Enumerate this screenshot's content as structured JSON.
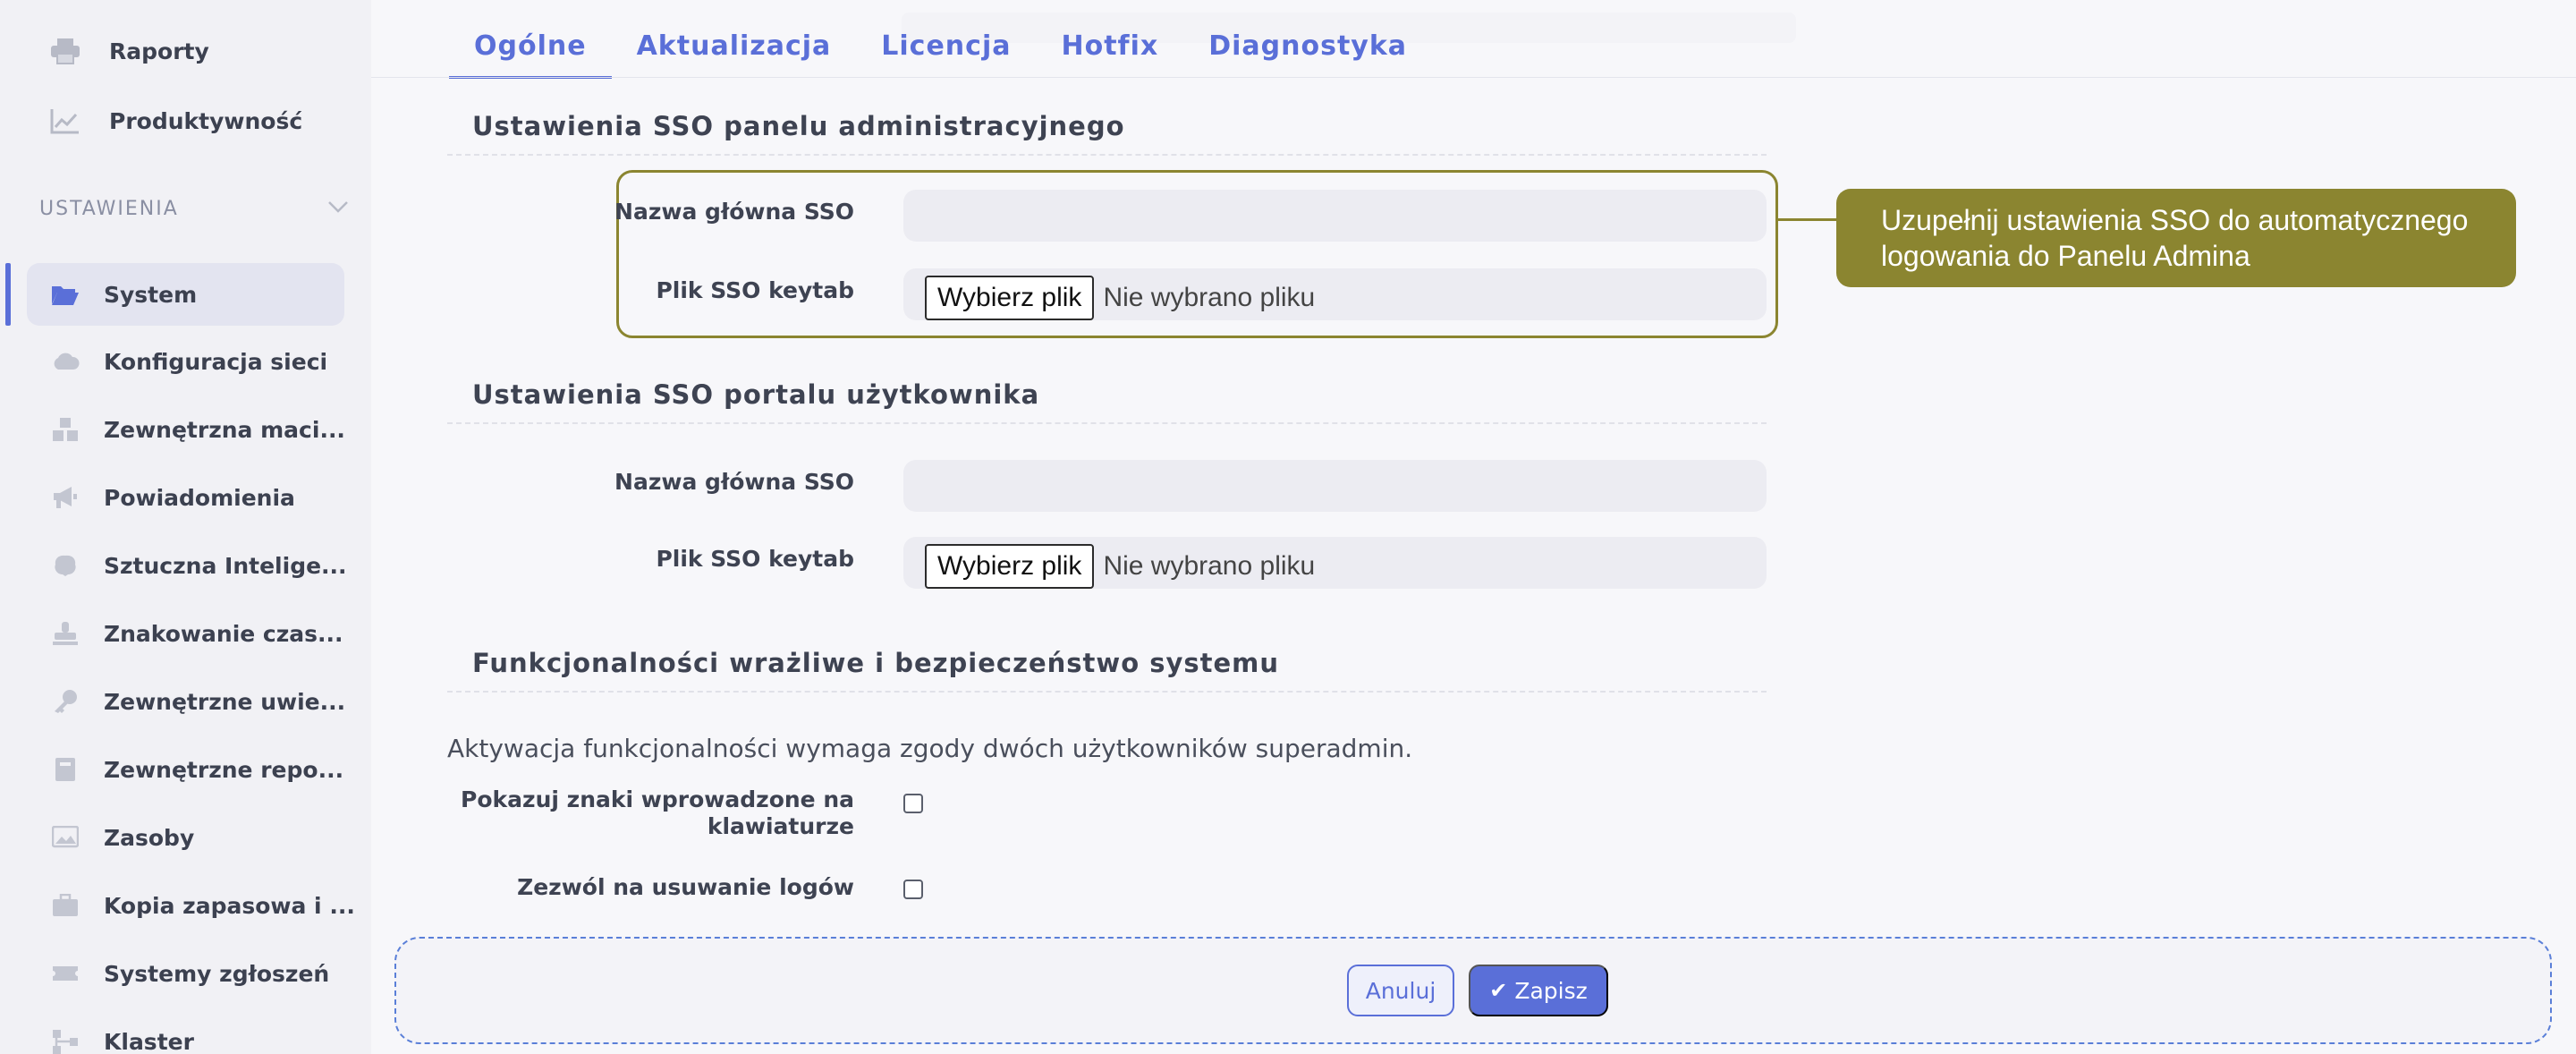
{
  "sidebar": {
    "top_items": [
      {
        "label": "Raporty",
        "icon": "printer-icon"
      },
      {
        "label": "Produktywność",
        "icon": "chart-line-icon"
      }
    ],
    "section_title": "USTAWIENIA",
    "items": [
      {
        "label": "System",
        "icon": "folder-open-icon",
        "active": true
      },
      {
        "label": "Konfiguracja sieci",
        "icon": "cloud-icon"
      },
      {
        "label": "Zewnętrzna maci...",
        "icon": "cubes-icon"
      },
      {
        "label": "Powiadomienia",
        "icon": "megaphone-icon"
      },
      {
        "label": "Sztuczna Intelige...",
        "icon": "brain-icon"
      },
      {
        "label": "Znakowanie czas...",
        "icon": "stamp-icon"
      },
      {
        "label": "Zewnętrzne uwie...",
        "icon": "key-icon"
      },
      {
        "label": "Zewnętrzne repo...",
        "icon": "book-icon"
      },
      {
        "label": "Zasoby",
        "icon": "image-icon"
      },
      {
        "label": "Kopia zapasowa i ...",
        "icon": "briefcase-icon"
      },
      {
        "label": "Systemy zgłoszeń",
        "icon": "ticket-icon"
      },
      {
        "label": "Klaster",
        "icon": "network-icon"
      }
    ]
  },
  "tabs": [
    {
      "label": "Ogólne",
      "active": true
    },
    {
      "label": "Aktualizacja"
    },
    {
      "label": "Licencja"
    },
    {
      "label": "Hotfix"
    },
    {
      "label": "Diagnostyka"
    }
  ],
  "sso_admin": {
    "heading": "Ustawienia SSO panelu administracyjnego",
    "name_label": "Nazwa główna SSO",
    "name_value": "",
    "keytab_label": "Plik SSO keytab",
    "file_button": "Wybierz plik",
    "file_status": "Nie wybrano pliku"
  },
  "callout": {
    "text": "Uzupełnij ustawienia SSO do automatycznego logowania do Panelu Admina",
    "color": "#8b8530"
  },
  "sso_user": {
    "heading": "Ustawienia SSO portalu użytkownika",
    "name_label": "Nazwa główna SSO",
    "name_value": "",
    "keytab_label": "Plik SSO keytab",
    "file_button": "Wybierz plik",
    "file_status": "Nie wybrano pliku"
  },
  "security": {
    "heading": "Funkcjonalności wrażliwe i bezpieczeństwo systemu",
    "info": "Aktywacja funkcjonalności wymaga zgody dwóch użytkowników superadmin.",
    "show_keys_label_line1": "Pokazuj znaki wprowadzone na",
    "show_keys_label_line2": "klawiaturze",
    "allow_delete_logs_label": "Zezwól na usuwanie logów"
  },
  "footer": {
    "cancel_label": "Anuluj",
    "save_label": "Zapisz"
  },
  "colors": {
    "accent": "#5a6fd8",
    "highlight": "#8b8530"
  }
}
